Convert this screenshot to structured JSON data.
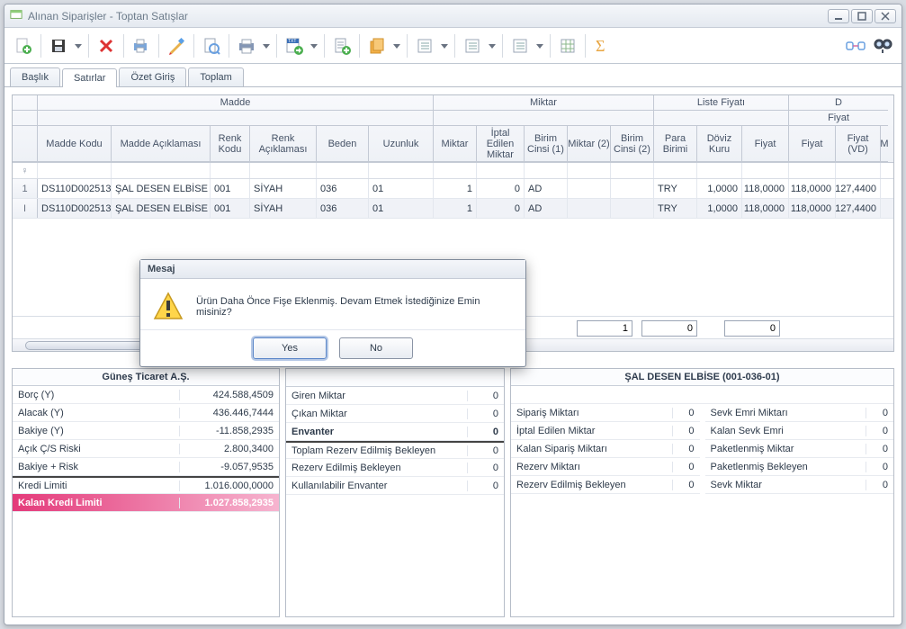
{
  "window": {
    "title": "Alınan Siparişler - Toptan Satışlar"
  },
  "tabs": {
    "items": [
      "Başlık",
      "Satırlar",
      "Özet Giriş",
      "Toplam"
    ],
    "activeIndex": 1
  },
  "grid": {
    "groupD": "D",
    "groupFiyat": "Fiyat",
    "groups": {
      "madde": "Madde",
      "miktar": "Miktar",
      "liste": "Liste Fiyatı"
    },
    "headers": {
      "rowNo": "",
      "maddeKodu": "Madde Kodu",
      "maddeAcik": "Madde Açıklaması",
      "renkKodu": "Renk Kodu",
      "renkAcik": "Renk Açıklaması",
      "beden": "Beden",
      "uzunluk": "Uzunluk",
      "miktar": "Miktar",
      "iptalMiktar": "İptal Edilen Miktar",
      "birim1": "Birim Cinsi (1)",
      "miktar2": "Miktar (2)",
      "birim2": "Birim Cinsi (2)",
      "paraBirimi": "Para Birimi",
      "dovizKuru": "Döviz Kuru",
      "fiyat": "Fiyat",
      "fiyat2": "Fiyat",
      "fiyatVD": "Fiyat (VD)",
      "lastM": "M"
    },
    "rows": [
      {
        "no": "1",
        "maddeKodu": "DS110D002513",
        "maddeAcik": "ŞAL DESEN ELBİSE",
        "renkKodu": "001",
        "renkAcik": "SİYAH",
        "beden": "036",
        "uzunluk": "01",
        "miktar": "1",
        "iptal": "0",
        "birim1": "AD",
        "miktar2": "",
        "birim2": "",
        "para": "TRY",
        "kur": "1,0000",
        "fiyat": "118,0000",
        "fiyat2": "118,0000",
        "fiyatVD": "127,4400"
      },
      {
        "no": "I",
        "maddeKodu": "DS110D002513",
        "maddeAcik": "ŞAL DESEN ELBİSE",
        "renkKodu": "001",
        "renkAcik": "SİYAH",
        "beden": "036",
        "uzunluk": "01",
        "miktar": "1",
        "iptal": "0",
        "birim1": "AD",
        "miktar2": "",
        "birim2": "",
        "para": "TRY",
        "kur": "1,0000",
        "fiyat": "118,0000",
        "fiyat2": "118,0000",
        "fiyatVD": "127,4400"
      }
    ],
    "totals": {
      "t1": "1",
      "t2": "0",
      "t3": "0"
    }
  },
  "leftPanel": {
    "title": "Güneş Ticaret A.Ş.",
    "items": [
      {
        "k": "Borç (Y)",
        "v": "424.588,4509"
      },
      {
        "k": "Alacak (Y)",
        "v": "436.446,7444"
      },
      {
        "k": "Bakiye (Y)",
        "v": "-11.858,2935"
      },
      {
        "k": "Açık Ç/S Riski",
        "v": "2.800,3400"
      },
      {
        "k": "Bakiye + Risk",
        "v": "-9.057,9535"
      },
      {
        "k": "Kredi Limiti",
        "v": "1.016.000,0000"
      },
      {
        "k": "Kalan Kredi Limiti",
        "v": "1.027.858,2935"
      }
    ]
  },
  "midPanel": {
    "items": [
      {
        "k": "Giren Miktar",
        "v": "0"
      },
      {
        "k": "Çıkan Miktar",
        "v": "0"
      },
      {
        "k": "Envanter",
        "v": "0"
      },
      {
        "k": "Toplam Rezerv Edilmiş Bekleyen",
        "v": "0"
      },
      {
        "k": "Rezerv Edilmiş Bekleyen",
        "v": "0"
      },
      {
        "k": "Kullanılabilir Envanter",
        "v": "0"
      }
    ]
  },
  "rightPanel": {
    "title": "ŞAL DESEN ELBİSE (001-036-01)",
    "left": [
      {
        "k": "Sipariş Miktarı",
        "v": "0"
      },
      {
        "k": "İptal Edilen Miktar",
        "v": "0"
      },
      {
        "k": "Kalan Sipariş Miktarı",
        "v": "0"
      },
      {
        "k": "Rezerv Miktarı",
        "v": "0"
      },
      {
        "k": "Rezerv Edilmiş Bekleyen",
        "v": "0"
      }
    ],
    "right": [
      {
        "k": "Sevk Emri Miktarı",
        "v": "0"
      },
      {
        "k": "Kalan Sevk Emri",
        "v": "0"
      },
      {
        "k": "Paketlenmiş Miktar",
        "v": "0"
      },
      {
        "k": "Paketlenmiş Bekleyen",
        "v": "0"
      },
      {
        "k": "Sevk Miktar",
        "v": "0"
      }
    ]
  },
  "modal": {
    "title": "Mesaj",
    "text": "Ürün Daha Önce Fişe Eklenmiş. Devam Etmek İstediğinize Emin misiniz?",
    "yes": "Yes",
    "no": "No"
  }
}
